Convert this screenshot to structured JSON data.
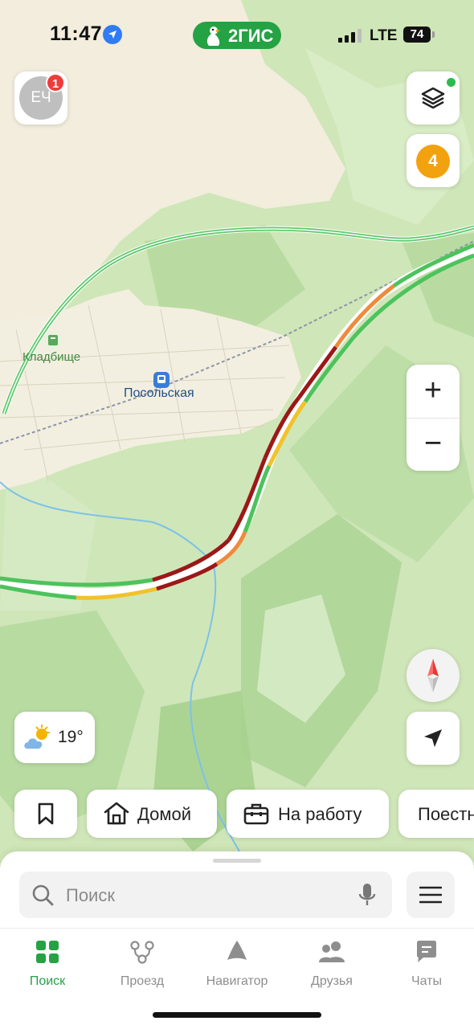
{
  "status_bar": {
    "time": "11:47",
    "location_icon": "location-arrow-icon",
    "brand": "2ГИС",
    "network": "LTE",
    "battery": "74"
  },
  "profile": {
    "initials": "ЕЧ",
    "notification_count": "1"
  },
  "layers": {
    "icon": "layers-icon",
    "active_indicator": true
  },
  "traffic": {
    "score": "4",
    "color": "#f2a20e"
  },
  "zoom": {
    "in": "+",
    "out": "−"
  },
  "map": {
    "labels": {
      "cemetery": "Кладбище",
      "station": "Посольская"
    },
    "colors": {
      "road_free": "#4cc35c",
      "road_medium": "#f1c22b",
      "road_slow": "#f08a3c",
      "road_jam": "#9b1818",
      "settlement": "#f3efe0",
      "water": "#7ec1e8"
    }
  },
  "weather": {
    "temperature": "19°",
    "icon": "partly-cloudy-icon"
  },
  "quick_actions": {
    "bookmark_icon": "bookmark-icon",
    "home": {
      "label": "Домой",
      "icon": "house-icon"
    },
    "work": {
      "label": "На работу",
      "icon": "briefcase-icon"
    },
    "more": {
      "label": "Поестн"
    }
  },
  "search": {
    "placeholder": "Поиск",
    "value": "",
    "mic_icon": "microphone-icon",
    "menu_icon": "hamburger-menu-icon"
  },
  "tab_bar": {
    "active_color": "#25a244",
    "tabs": [
      {
        "label": "Поиск",
        "icon": "grid-icon",
        "active": true
      },
      {
        "label": "Проезд",
        "icon": "route-icon",
        "active": false
      },
      {
        "label": "Навигатор",
        "icon": "navigator-icon",
        "active": false
      },
      {
        "label": "Друзья",
        "icon": "friends-icon",
        "active": false
      },
      {
        "label": "Чаты",
        "icon": "chat-icon",
        "active": false
      }
    ]
  }
}
